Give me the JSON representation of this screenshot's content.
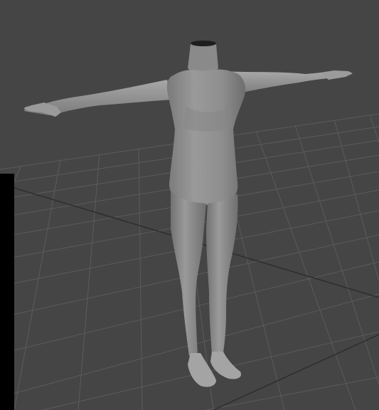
{
  "viewport": {
    "view_type": "perspective",
    "background_color": "#454545",
    "grid": {
      "visible": true,
      "line_color": "#5a5a5a",
      "axis_color": "#2e2e2e"
    },
    "model": {
      "name": "headless-t-pose-body-mesh",
      "pose": "T-pose",
      "shading": "smooth-shaded",
      "base_color": "#8c8c8c",
      "highlight_color": "#a5a5a5"
    },
    "side_panel": {
      "visible": true,
      "color": "#000000"
    }
  }
}
